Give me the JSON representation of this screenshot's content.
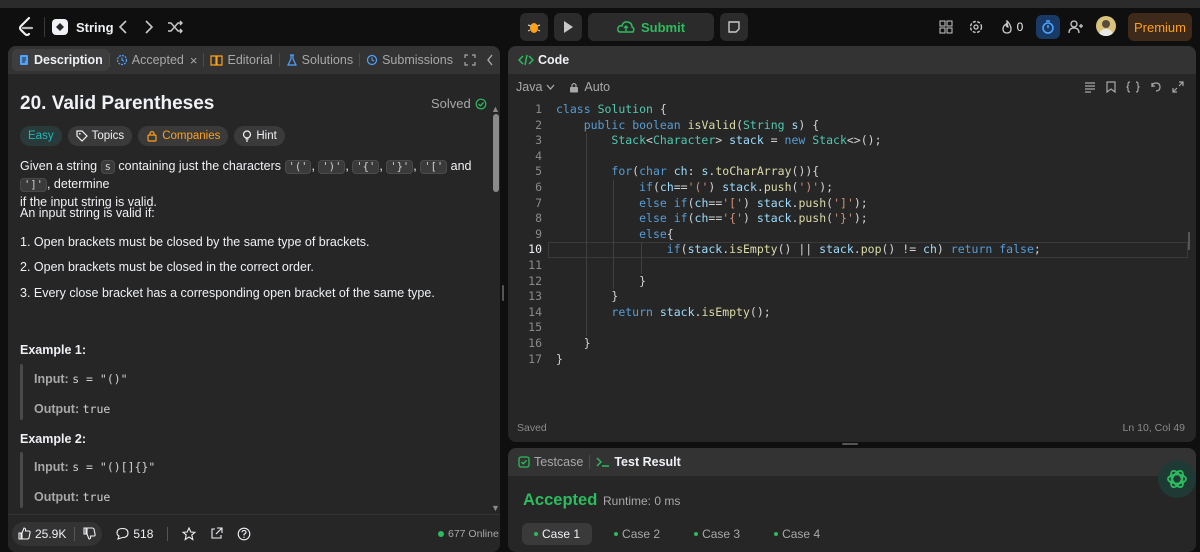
{
  "topbar": {
    "problem_list_label": "String",
    "submit_label": "Submit",
    "streak_count": "0",
    "premium_label": "Premium"
  },
  "left_tabs": {
    "description": "Description",
    "accepted": "Accepted",
    "editorial": "Editorial",
    "solutions": "Solutions",
    "submissions": "Submissions"
  },
  "problem": {
    "title": "20. Valid Parentheses",
    "status": "Solved",
    "tags": {
      "difficulty": "Easy",
      "topics": "Topics",
      "companies": "Companies",
      "hint": "Hint"
    },
    "desc_prefix": "Given a string",
    "desc_var": "s",
    "desc_mid": "containing just the characters",
    "chars": [
      "'('",
      "')'",
      "'{'",
      "'}'",
      "'['",
      "']'"
    ],
    "desc_and": "and",
    "desc_suffix": ", determine",
    "desc_line2": "if the input string is valid.",
    "valid_if": "An input string is valid if:",
    "rules": [
      "1. Open brackets must be closed by the same type of brackets.",
      "2. Open brackets must be closed in the correct order.",
      "3. Every close bracket has a corresponding open bracket of the same type."
    ],
    "examples": [
      {
        "title": "Example 1:",
        "input_label": "Input:",
        "input": "s = \"()\"",
        "output_label": "Output:",
        "output": "true"
      },
      {
        "title": "Example 2:",
        "input_label": "Input:",
        "input": "s = \"()[]{}\"",
        "output_label": "Output:",
        "output": "true"
      }
    ]
  },
  "footer": {
    "likes": "25.9K",
    "comments": "518",
    "online": "677 Online"
  },
  "code_panel": {
    "tab_label": "Code",
    "language": "Java",
    "autocomplete": "Auto",
    "status_left": "Saved",
    "status_right": "Ln 10, Col 49",
    "current_line": 10,
    "lines": [
      "class Solution {",
      "    public boolean isValid(String s) {",
      "        Stack<Character> stack = new Stack<>();",
      "",
      "        for(char ch: s.toCharArray()){",
      "            if(ch=='(') stack.push(')');",
      "            else if(ch=='[') stack.push(']');",
      "            else if(ch=='{') stack.push('}');",
      "            else{",
      "                if(stack.isEmpty() || stack.pop() != ch) return false;",
      "",
      "            }",
      "        }",
      "        return stack.isEmpty();",
      "",
      "    }",
      "}"
    ]
  },
  "result_panel": {
    "testcase_tab": "Testcase",
    "result_tab": "Test Result",
    "verdict": "Accepted",
    "runtime": "Runtime: 0 ms",
    "cases": [
      "Case 1",
      "Case 2",
      "Case 3",
      "Case 4"
    ]
  },
  "colors": {
    "accent_green": "#2cbb5d",
    "accent_orange": "#ffa116",
    "easy_teal": "#1cbaba",
    "panel_bg": "#262626"
  }
}
